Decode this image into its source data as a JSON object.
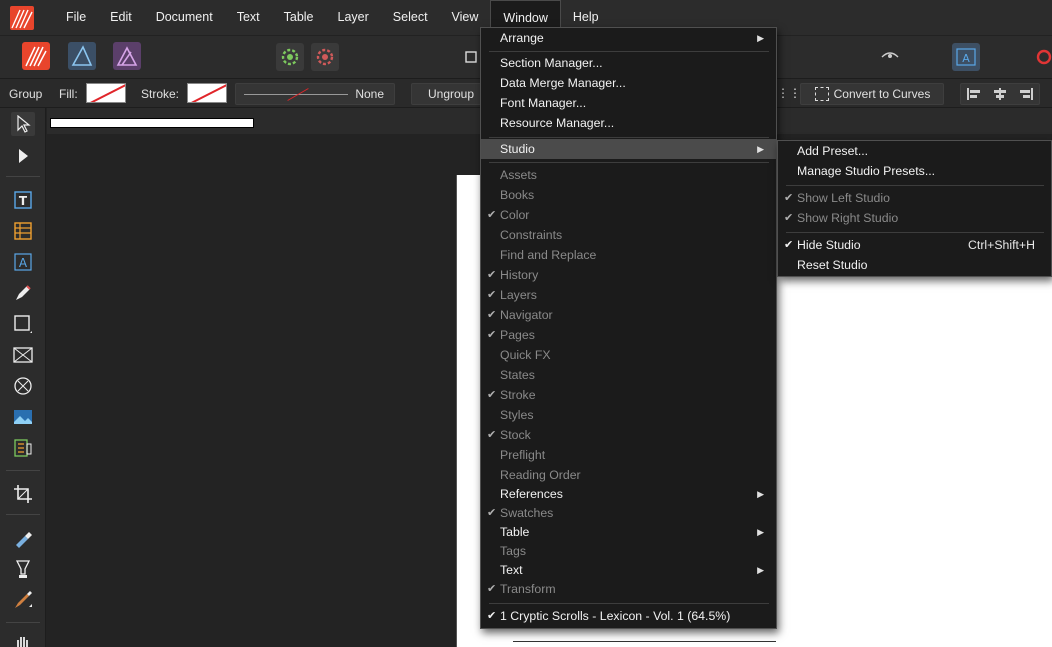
{
  "menubar": {
    "items": [
      {
        "label": "File"
      },
      {
        "label": "Edit"
      },
      {
        "label": "Document"
      },
      {
        "label": "Text"
      },
      {
        "label": "Table"
      },
      {
        "label": "Layer"
      },
      {
        "label": "Select"
      },
      {
        "label": "View"
      },
      {
        "label": "Window",
        "active": true
      },
      {
        "label": "Help"
      }
    ]
  },
  "context": {
    "group_label": "Group",
    "fill_label": "Fill:",
    "stroke_label": "Stroke:",
    "stroke_style": "None",
    "ungroup_label": "Ungroup",
    "convert_label": "Convert to Curves"
  },
  "window_menu": {
    "arrange": "Arrange",
    "section_manager": "Section Manager...",
    "data_merge_manager": "Data Merge Manager...",
    "font_manager": "Font Manager...",
    "resource_manager": "Resource Manager...",
    "studio": "Studio",
    "panels": [
      {
        "label": "Assets",
        "checked": false
      },
      {
        "label": "Books",
        "checked": false
      },
      {
        "label": "Color",
        "checked": true
      },
      {
        "label": "Constraints",
        "checked": false
      },
      {
        "label": "Find and Replace",
        "checked": false
      },
      {
        "label": "History",
        "checked": true
      },
      {
        "label": "Layers",
        "checked": true
      },
      {
        "label": "Navigator",
        "checked": true
      },
      {
        "label": "Pages",
        "checked": true
      },
      {
        "label": "Quick FX",
        "checked": false
      },
      {
        "label": "States",
        "checked": false
      },
      {
        "label": "Stroke",
        "checked": true
      },
      {
        "label": "Styles",
        "checked": false
      },
      {
        "label": "Stock",
        "checked": true
      },
      {
        "label": "Preflight",
        "checked": false
      },
      {
        "label": "Reading Order",
        "checked": false
      }
    ],
    "references": "References",
    "swatches": "Swatches",
    "table": "Table",
    "tags": "Tags",
    "text": "Text",
    "transform": "Transform",
    "document": "1 Cryptic Scrolls - Lexicon - Vol. 1 (64.5%)",
    "check_glyph": "✔",
    "arrow_glyph": "▶"
  },
  "studio_submenu": {
    "add_preset": "Add Preset...",
    "manage_presets": "Manage Studio Presets...",
    "show_left": "Show Left Studio",
    "show_right": "Show Right Studio",
    "hide_studio": "Hide Studio",
    "hide_shortcut": "Ctrl+Shift+H",
    "reset_studio": "Reset Studio"
  },
  "colors": {
    "accent": "#e8452c",
    "menu_bg": "#1b1b1b",
    "highlight": "#4b4b4b",
    "disabled_text": "#8a8a8a"
  },
  "icons": {
    "tools": [
      "move-icon",
      "node-icon",
      "frame-text-icon",
      "table-icon",
      "artistic-text-icon",
      "pen-icon",
      "rectangle-icon",
      "picture-frame-icon",
      "ellipse-icon",
      "place-image-icon",
      "vector-crop-icon",
      "crop-icon",
      "color-picker-icon",
      "fill-icon",
      "brush-icon",
      "hand-icon"
    ]
  }
}
